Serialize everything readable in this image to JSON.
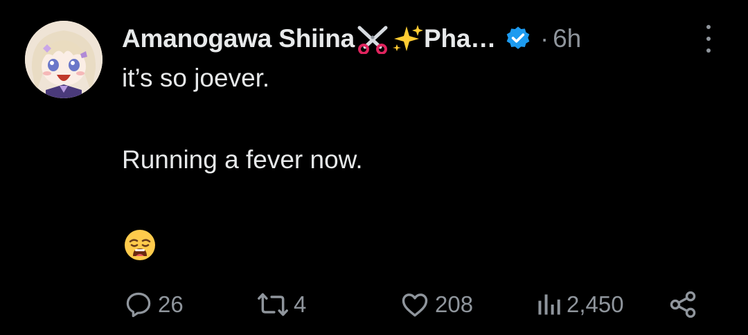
{
  "post": {
    "author": {
      "display_name": "Amanogawa Shiina",
      "name_suffix": "Pha…",
      "verified": true
    },
    "separator": "·",
    "time_ago": "6h",
    "text_lines": [
      "it’s so joever.",
      "Running a fever now."
    ],
    "emoji": "weary-face"
  },
  "actions": {
    "replies": "26",
    "reposts": "4",
    "likes": "208",
    "views": "2,450"
  },
  "colors": {
    "background": "#000000",
    "text": "#e7e9ea",
    "secondary": "#8f959c",
    "verified": "#1d9bf0"
  }
}
